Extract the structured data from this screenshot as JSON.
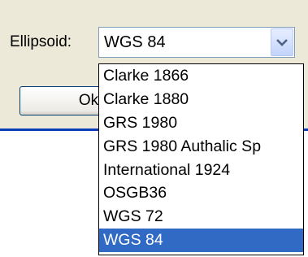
{
  "ellipsoid": {
    "label": "Ellipsoid:",
    "selected_value": "WGS 84",
    "options": [
      "Clarke 1866",
      "Clarke 1880",
      "GRS 1980",
      "GRS 1980 Authalic Sp",
      "International 1924",
      "OSGB36",
      "WGS 72",
      "WGS 84"
    ],
    "highlighted_option": "WGS 84"
  },
  "buttons": {
    "ok_label": "Ok"
  },
  "colors": {
    "dialog_background": "#ece9d8",
    "selection_highlight": "#316ac5",
    "separator_line": "#0a3fb7",
    "combo_border": "#7f9db9"
  }
}
